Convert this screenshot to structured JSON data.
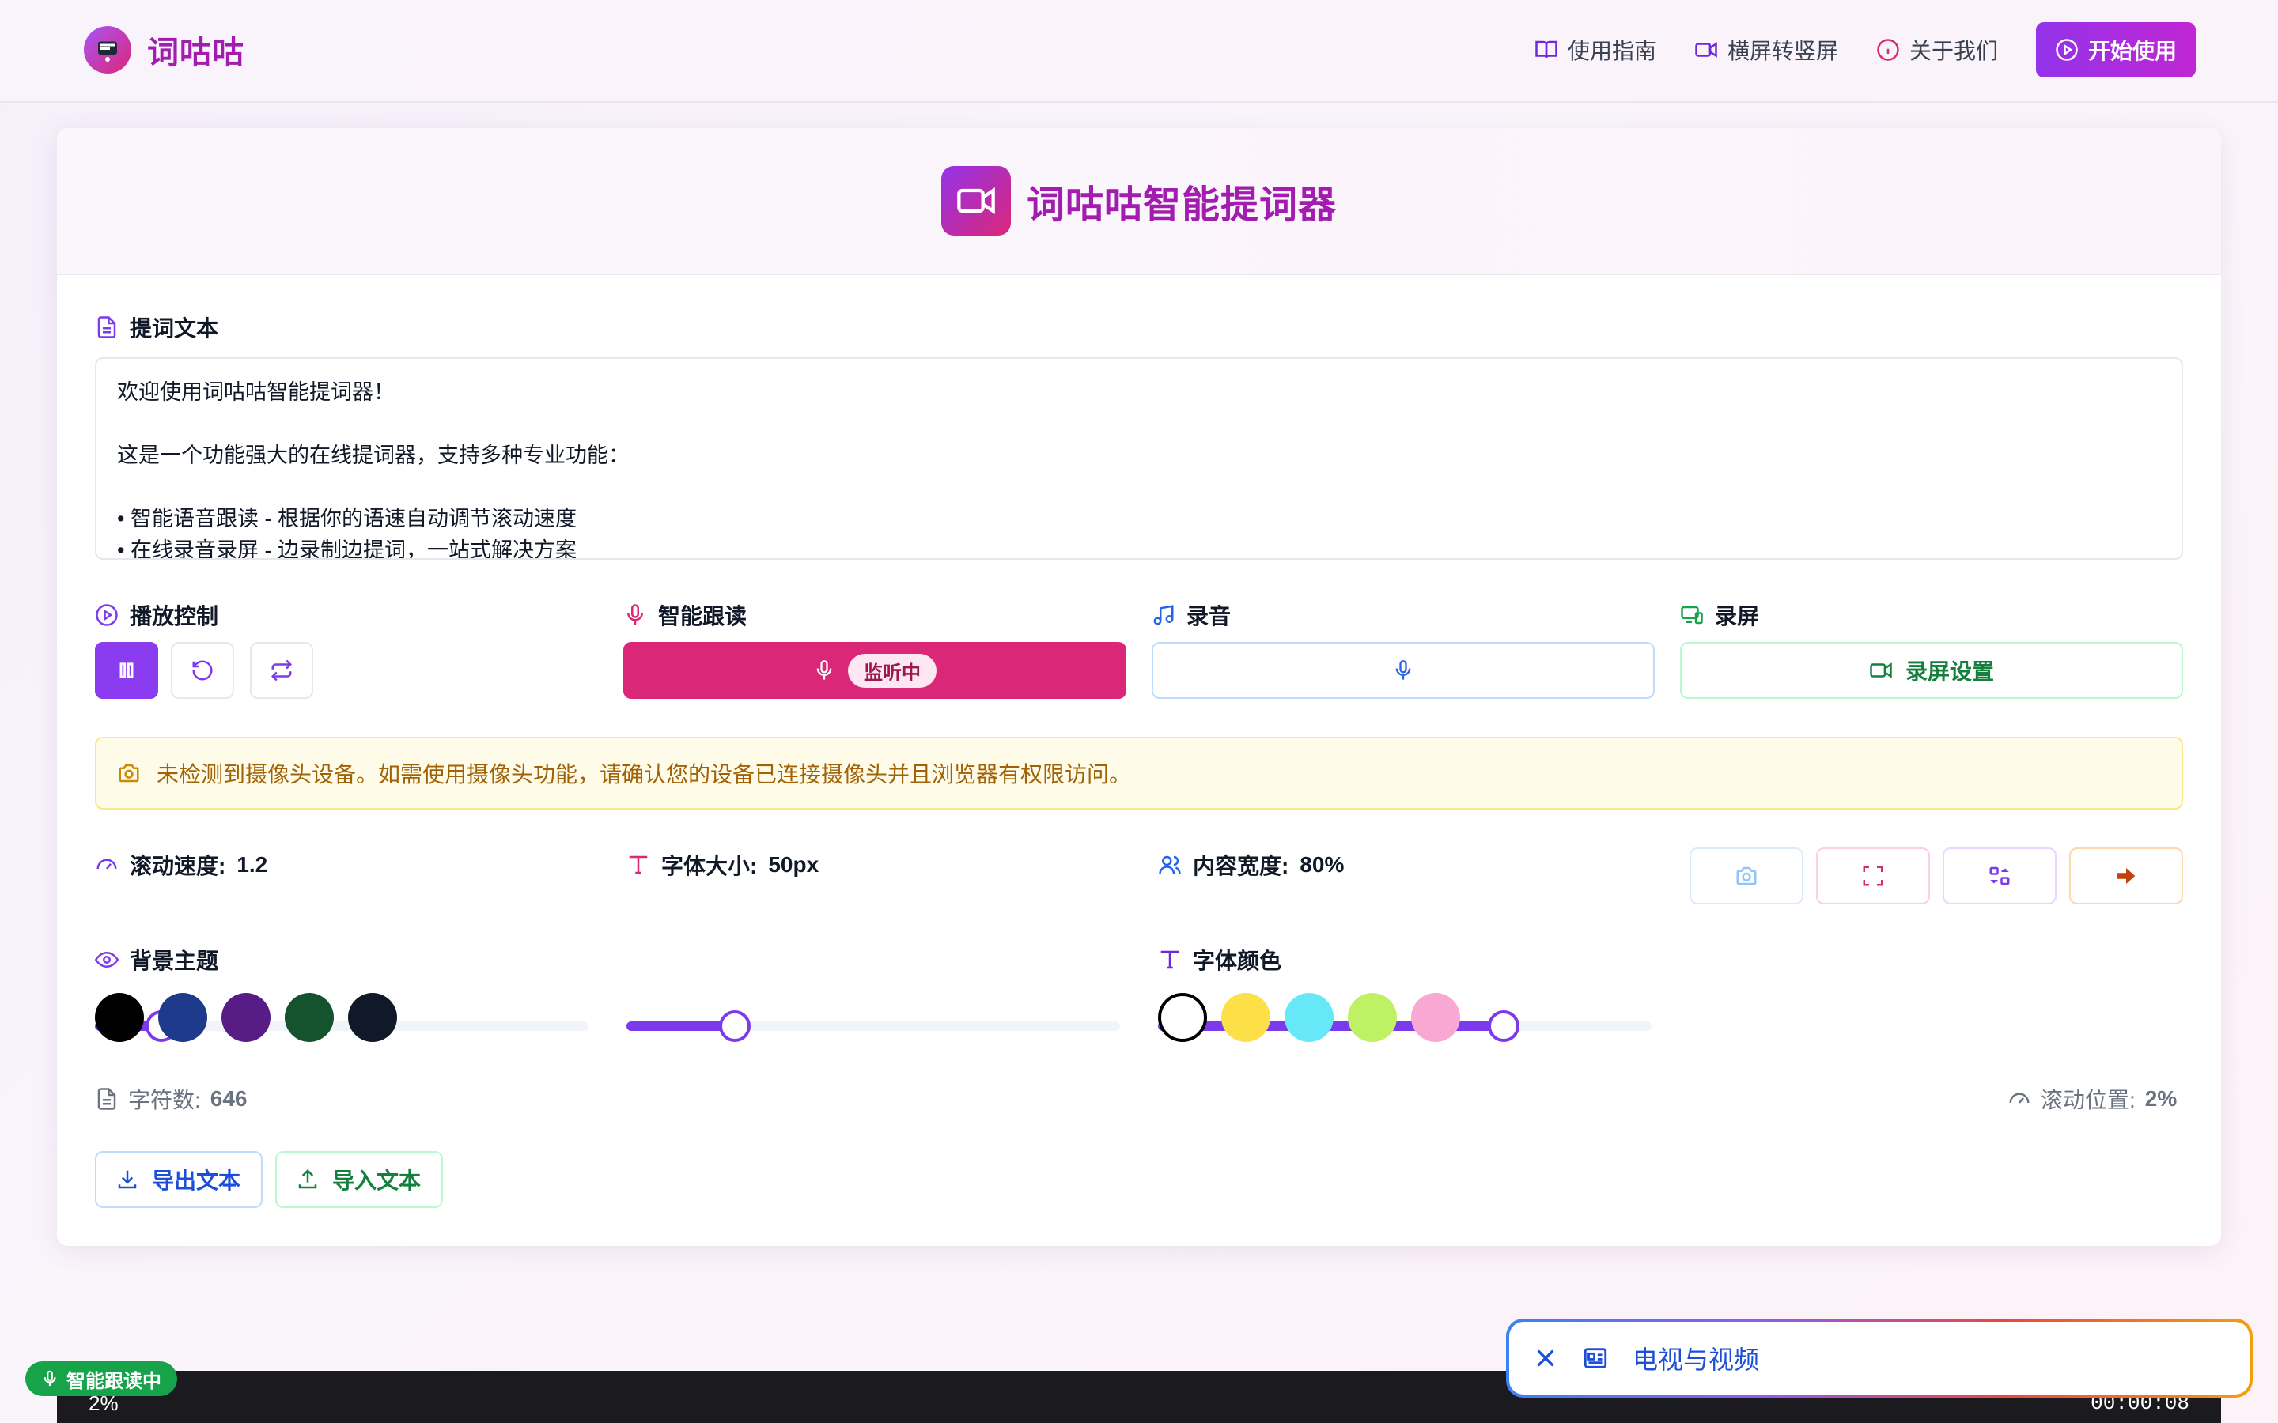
{
  "header": {
    "brand": "词咕咕",
    "nav": [
      {
        "label": "使用指南",
        "icon": "book-icon"
      },
      {
        "label": "横屏转竖屏",
        "icon": "video-icon"
      },
      {
        "label": "关于我们",
        "icon": "info-icon"
      }
    ],
    "cta": "开始使用"
  },
  "app": {
    "title": "词咕咕智能提词器"
  },
  "script": {
    "label": "提词文本",
    "lines": [
      "欢迎使用词咕咕智能提词器！",
      "",
      "这是一个功能强大的在线提词器，支持多种专业功能：",
      "",
      "• 智能语音跟读 - 根据你的语速自动调节滚动速度",
      "• 在线录音录屏 - 边录制边提词，一站式解决方案"
    ]
  },
  "controls": {
    "playback_label": "播放控制",
    "tracking_label": "智能跟读",
    "tracking_state": "监听中",
    "recording_label": "录音",
    "screen_label": "录屏",
    "screen_settings": "录屏设置"
  },
  "warning": "未检测到摄像头设备。如需使用摄像头功能，请确认您的设备已连接摄像头并且浏览器有权限访问。",
  "sliders": {
    "speed_label": "滚动速度:",
    "speed_value": "1.2",
    "speed_fraction": 0.135,
    "font_label": "字体大小:",
    "font_value": "50px",
    "font_fraction": 0.22,
    "width_label": "内容宽度:",
    "width_value": "80%",
    "width_fraction": 0.7
  },
  "theme": {
    "bg_label": "背景主题",
    "bg_colors": [
      "#000000",
      "#1e3a8a",
      "#581c87",
      "#14532d",
      "#111827"
    ],
    "font_color_label": "字体颜色",
    "font_colors": [
      "#ffffff",
      "#fde047",
      "#67e8f9",
      "#bef264",
      "#f9a8d4"
    ]
  },
  "stats": {
    "chars_label": "字符数:",
    "chars_value": "646",
    "scroll_label": "滚动位置:",
    "scroll_value": "2%"
  },
  "file": {
    "export": "导出文本",
    "import": "导入文本"
  },
  "prompter": {
    "percent": "2%",
    "time": "00:00:08",
    "tracking_badge": "智能跟读中"
  },
  "notification": {
    "text": "电视与视频"
  },
  "colors": {
    "accent": "#8b3cf0",
    "brand": "#a21caf",
    "listen": "#db2777"
  }
}
